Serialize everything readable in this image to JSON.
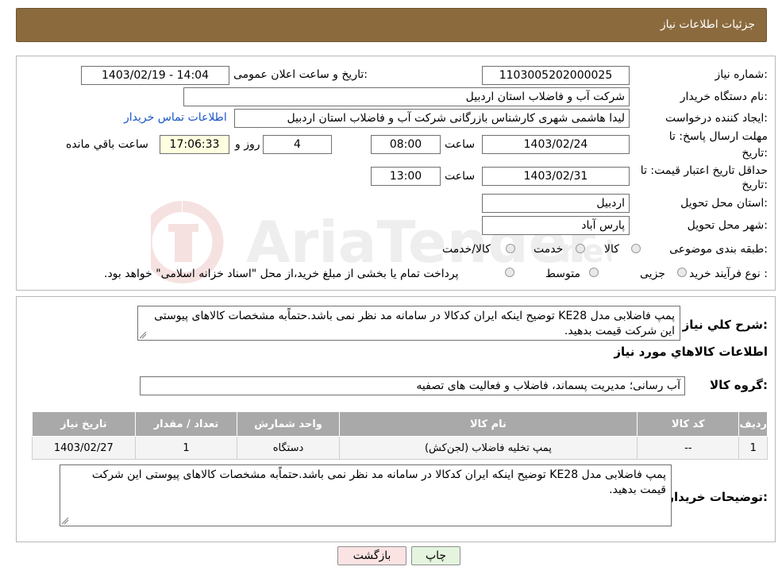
{
  "header": {
    "title": "جزئیات اطلاعات نیاز"
  },
  "form": {
    "need_number_label": "شماره نیاز:",
    "need_number": "1103005202000025",
    "announce_label": "تاریخ و ساعت اعلان عمومی:",
    "announce_value": "1403/02/19 - 14:04",
    "buyer_org_label": "نام دستگاه خریدار:",
    "buyer_org": "شرکت آب و فاضلاب استان اردبیل",
    "creator_label": "ایجاد کننده درخواست:",
    "creator": "لیدا  هاشمی شهری کارشناس بازرگانی شرکت آب و فاضلاب استان اردبیل",
    "contact_link": "اطلاعات تماس خریدار",
    "deadline_label_1": "مهلت ارسال پاسخ: تا",
    "deadline_label_2": "تاریخ:",
    "deadline_date": "1403/02/24",
    "time_label": "ساعت",
    "deadline_time": "08:00",
    "days_value": "4",
    "days_label": "روز و",
    "remaining_time": "17:06:33",
    "remaining_label": "ساعت باقي مانده",
    "validity_label_1": "حداقل تاریخ اعتبار قیمت: تا",
    "validity_label_2": "تاریخ:",
    "validity_date": "1403/02/31",
    "validity_time": "13:00",
    "province_label": "استان محل تحویل:",
    "province": "اردبیل",
    "city_label": "شهر محل تحویل:",
    "city": "پارس آباد",
    "category_label": "طبقه بندی موضوعی:",
    "category_options": [
      "کالا",
      "خدمت",
      "کالا/خدمت"
    ],
    "process_label": "نوع فرآیند خرید :",
    "process_options": [
      "جزیی",
      "متوسط"
    ],
    "process_note": "پرداخت تمام یا بخشی از مبلغ خرید،از محل \"اسناد خزانه اسلامی\" خواهد بود."
  },
  "summary": {
    "label": "شرح كلي نياز:",
    "text": "پمپ فاضلابی مدل KE28    توضیح اینکه ایران کدکالا در سامانه مد نظر نمی باشد.حتماًبه مشخصات کالاهای پیوستی این شرکت قیمت بدهید.",
    "items_title": "اطلاعات کالاهاي مورد نياز",
    "group_label": "گروه کالا:",
    "group_value": "آب رسانی؛ مدیریت پسماند، فاضلاب و فعالیت های تصفیه"
  },
  "table": {
    "headers": [
      "رديف",
      "کد کالا",
      "نام کالا",
      "واحد شمارش",
      "تعداد / مقدار",
      "تاریخ نیاز"
    ],
    "rows": [
      [
        "1",
        "--",
        "پمپ تخلیه فاضلاب (لجن‌کش)",
        "دستگاه",
        "1",
        "1403/02/27"
      ]
    ]
  },
  "buyer_notes": {
    "label": "توضیحات خریدار:",
    "text": "پمپ فاضلابی مدل KE28    توضیح اینکه ایران کدکالا در سامانه مد نظر نمی باشد.حتماًبه مشخصات کالاهای پیوستی این شرکت قیمت بدهید."
  },
  "buttons": {
    "print": "چاپ",
    "back": "بازگشت"
  },
  "colors": {
    "header_bg": "#8b6b3e",
    "back_button_bg": "#fbe3e3",
    "print_button_bg": "#e4f4de",
    "link": "#1a57c4"
  }
}
